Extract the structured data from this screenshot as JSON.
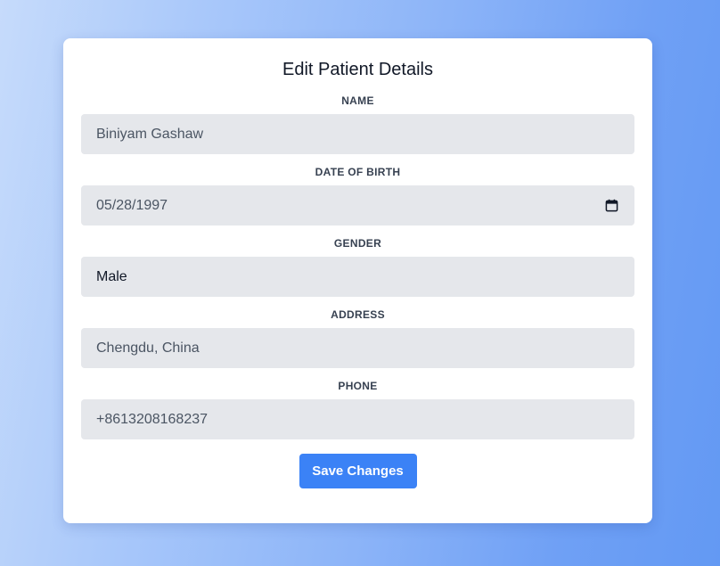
{
  "form": {
    "title": "Edit Patient Details",
    "fields": [
      {
        "label": "NAME",
        "value": "Biniyam Gashaw"
      },
      {
        "label": "DATE OF BIRTH",
        "value": "05/28/1997",
        "icon": "calendar-icon"
      },
      {
        "label": "GENDER",
        "value": "Male"
      },
      {
        "label": "ADDRESS",
        "value": "Chengdu, China"
      },
      {
        "label": "PHONE",
        "value": "+8613208168237"
      }
    ],
    "save_label": "Save Changes"
  },
  "colors": {
    "accent": "#3b82f6",
    "field_bg": "#e5e7eb",
    "card_bg": "#ffffff"
  }
}
